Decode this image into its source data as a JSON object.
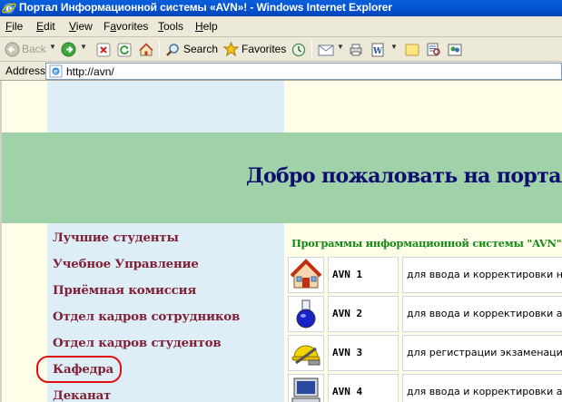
{
  "window": {
    "title": "Портал Информационной системы «AVN»! - Windows Internet Explorer"
  },
  "menu": [
    {
      "label": "File",
      "accel": "F"
    },
    {
      "label": "Edit",
      "accel": "E"
    },
    {
      "label": "View",
      "accel": "V"
    },
    {
      "label": "Favorites",
      "accel": "a"
    },
    {
      "label": "Tools",
      "accel": "T"
    },
    {
      "label": "Help",
      "accel": "H"
    }
  ],
  "toolbar": {
    "back_label": "Back",
    "search_label": "Search",
    "favorites_label": "Favorites"
  },
  "address": {
    "label": "Address",
    "value": "http://avn/"
  },
  "page": {
    "welcome": "Добро пожаловать на портал Ин",
    "nav": [
      "Лучшие студенты",
      "Учебное Управление",
      "Приёмная комиссия",
      "Отдел кадров сотрудников",
      "Отдел кадров студентов",
      "Кафедра",
      "Деканат"
    ],
    "programs_title": "Программы информационной системы \"AVN\"",
    "programs": [
      {
        "name": "AVN 1",
        "desc": "для ввода и корректировки н",
        "icon": "house-icon"
      },
      {
        "name": "AVN 2",
        "desc": "для ввода и корректировки а",
        "icon": "flask-icon"
      },
      {
        "name": "AVN 3",
        "desc": "для регистрации экзаменаци",
        "icon": "hardhat-icon"
      },
      {
        "name": "AVN 4",
        "desc": "для ввода и корректировки а",
        "icon": "computer-icon"
      }
    ]
  },
  "colors": {
    "titlebar": "#0455d6",
    "banner": "#9fd2a8",
    "sidebar": "#deeef7",
    "nav_link": "#802036",
    "welcome": "#0f0e70",
    "programs_title": "#1a8a1a",
    "highlight_ring": "#e01010"
  }
}
